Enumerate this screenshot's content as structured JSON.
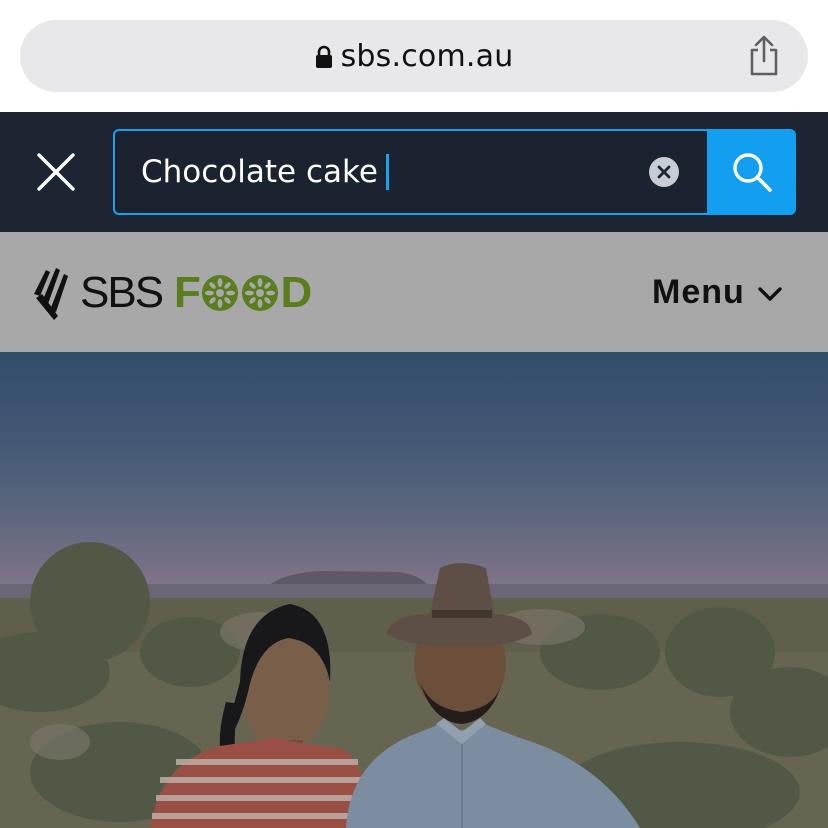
{
  "browser": {
    "url": "sbs.com.au",
    "icons": {
      "lock": "lock-icon",
      "share": "share-icon"
    }
  },
  "search": {
    "value": "Chocolate cake",
    "icons": {
      "close": "close-icon",
      "clear": "clear-icon",
      "submit": "search-icon"
    }
  },
  "header": {
    "logo_sbs": "SBS",
    "logo_food_start": "F",
    "logo_food_end": "D",
    "menu_label": "Menu",
    "icons": {
      "menu": "chevron-down-icon"
    }
  },
  "colors": {
    "accent": "#139ff0",
    "search_bar_bg": "#1d2532",
    "brand_green": "#5a7d1e"
  }
}
